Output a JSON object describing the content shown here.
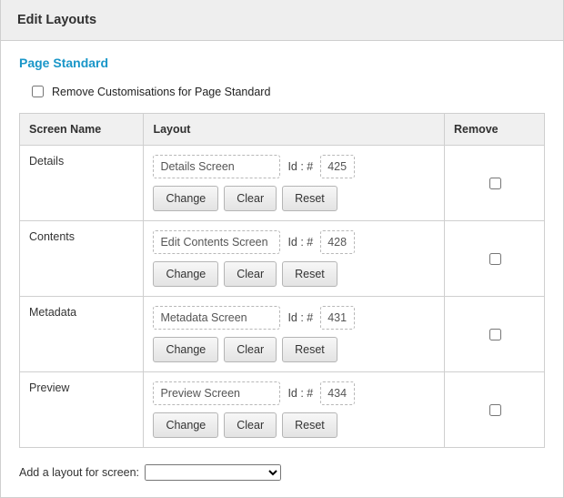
{
  "panel": {
    "title": "Edit Layouts"
  },
  "section": {
    "title": "Page Standard"
  },
  "removeCustomisations": {
    "label": "Remove Customisations for Page Standard",
    "checked": false
  },
  "columns": {
    "screenName": "Screen Name",
    "layout": "Layout",
    "remove": "Remove"
  },
  "idLabel": "Id : #",
  "buttons": {
    "change": "Change",
    "clear": "Clear",
    "reset": "Reset"
  },
  "rows": [
    {
      "screenName": "Details",
      "layoutName": "Details Screen",
      "id": "425",
      "remove": false
    },
    {
      "screenName": "Contents",
      "layoutName": "Edit Contents Screen",
      "id": "428",
      "remove": false
    },
    {
      "screenName": "Metadata",
      "layoutName": "Metadata Screen",
      "id": "431",
      "remove": false
    },
    {
      "screenName": "Preview",
      "layoutName": "Preview Screen",
      "id": "434",
      "remove": false
    }
  ],
  "addLayout": {
    "label": "Add a layout for screen:",
    "selected": ""
  }
}
